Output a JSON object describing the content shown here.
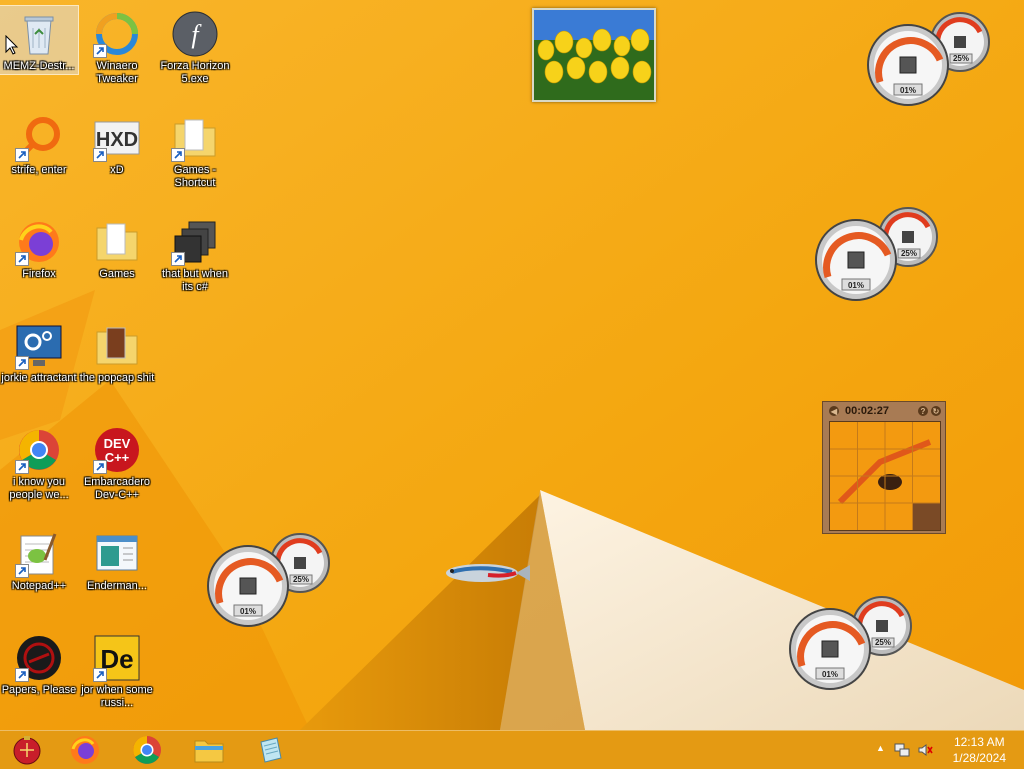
{
  "desktop": {
    "icons": [
      {
        "label": "MEMZ-Destr..."
      },
      {
        "label": "Winaero Tweaker"
      },
      {
        "label": "Forza Horizon 5.exe"
      },
      {
        "label": "strife, enter"
      },
      {
        "label": "xD"
      },
      {
        "label": "Games - Shortcut"
      },
      {
        "label": "Firefox"
      },
      {
        "label": "Games"
      },
      {
        "label": "that but when its c#"
      },
      {
        "label": "jorkie attractant"
      },
      {
        "label": "the popcap shit"
      },
      {
        "label": "i know you people we..."
      },
      {
        "label": "Embarcadero Dev-C++"
      },
      {
        "label": "Notepad++"
      },
      {
        "label": "Enderman..."
      },
      {
        "label": "Papers, Please"
      },
      {
        "label": "jor when some russi..."
      }
    ],
    "icon_names": {
      "recycle": "recycle-bin-icon",
      "winaero": "winaero-icon",
      "flash": "flash-icon"
    }
  },
  "gadgets": {
    "cpu_meters": [
      {
        "cpu": "01%",
        "memory": "25%"
      },
      {
        "cpu": "01%",
        "memory": "25%"
      },
      {
        "cpu": "01%",
        "memory": "25%"
      },
      {
        "cpu": "01%",
        "memory": "25%"
      }
    ],
    "puzzle": {
      "timer": "00:02:27"
    }
  },
  "taskbar": {
    "pinned": [
      "start-orb",
      "firefox",
      "chrome",
      "file-explorer",
      "notepad-app"
    ],
    "clock": {
      "time": "12:13 AM",
      "date": "1/28/2024"
    }
  },
  "colors": {
    "wallpaper_main": "#f6ae10",
    "wallpaper_cream": "#f7e8cf",
    "taskbar": "#e0961a"
  }
}
